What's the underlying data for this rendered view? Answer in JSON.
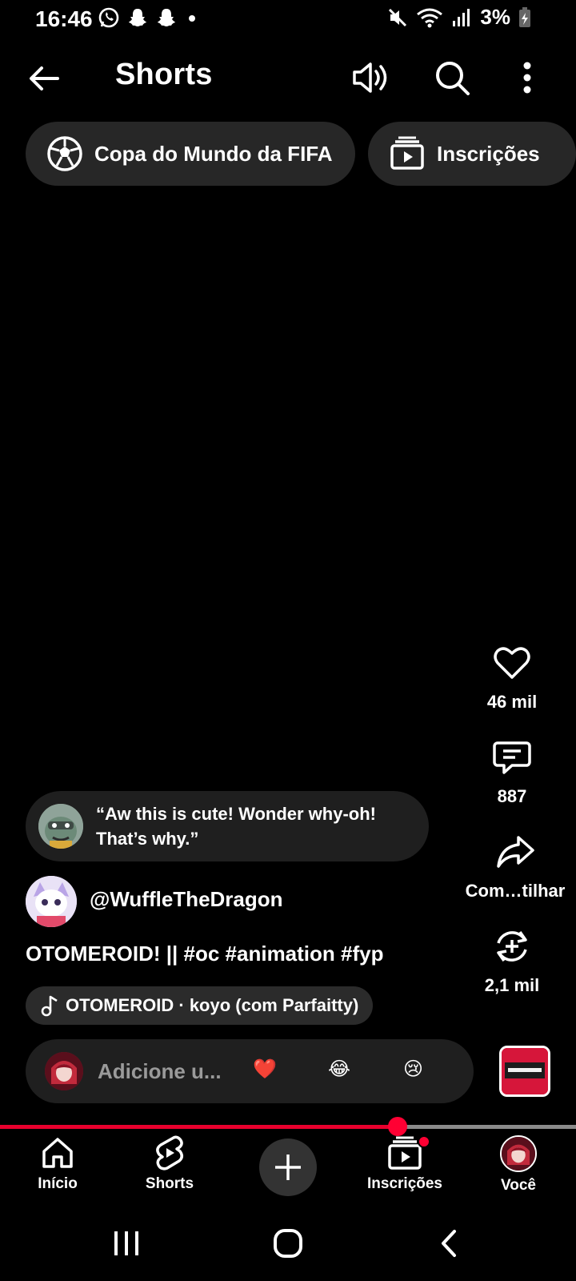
{
  "status_bar": {
    "time": "16:46",
    "battery_percent": "3%",
    "icons": [
      "whatsapp-icon",
      "snapchat-icon",
      "snapchat-icon",
      "dot-icon",
      "mute-icon",
      "wifi-icon",
      "signal-icon",
      "battery-charging-icon"
    ]
  },
  "header": {
    "title": "Shorts",
    "icons": [
      "back-arrow-icon",
      "volume-icon",
      "search-icon",
      "more-vert-icon"
    ]
  },
  "chips": [
    {
      "label": "Copa do Mundo da FIFA",
      "icon": "soccer-ball-icon"
    },
    {
      "label": "Inscrições",
      "icon": "subscriptions-icon"
    }
  ],
  "actions": {
    "likes": "46 mil",
    "comments": "887",
    "share": "Com…tilhar",
    "remix": "2,1 mil"
  },
  "top_comment": {
    "text_line1": "“Aw this is cute! Wonder why-oh!",
    "text_line2": "That’s why.”"
  },
  "channel": {
    "handle": "@WuffleTheDragon"
  },
  "video": {
    "title": "OTOMEROID! || #oc #animation #fyp",
    "music": "OTOMEROID · koyo (com Parfaitty)",
    "progress": 0.69
  },
  "reply": {
    "placeholder": "Adicione u...",
    "emojis": [
      "❤️",
      "😂",
      "😢"
    ]
  },
  "bottom_nav": [
    {
      "label": "Início",
      "icon": "home-icon"
    },
    {
      "label": "Shorts",
      "icon": "shorts-icon"
    },
    {
      "label": "",
      "icon": "plus-icon"
    },
    {
      "label": "Inscrições",
      "icon": "subscriptions-icon"
    },
    {
      "label": "Você",
      "icon": "avatar"
    }
  ],
  "colors": {
    "accent": "#ff0033",
    "chip_bg": "#272727"
  }
}
